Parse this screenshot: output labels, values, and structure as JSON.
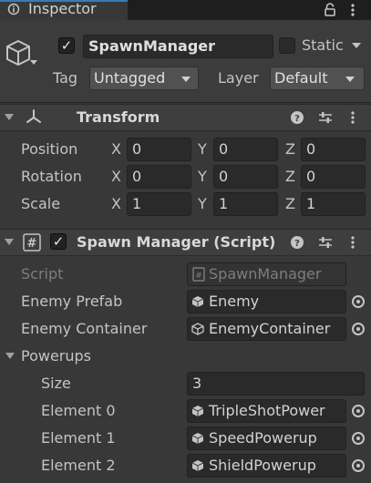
{
  "window": {
    "tab_title": "Inspector"
  },
  "header": {
    "object_name": "SpawnManager",
    "static_label": "Static",
    "tag_label": "Tag",
    "tag_value": "Untagged",
    "layer_label": "Layer",
    "layer_value": "Default"
  },
  "transform": {
    "title": "Transform",
    "rows": [
      {
        "label": "Position",
        "x": "0",
        "y": "0",
        "z": "0"
      },
      {
        "label": "Rotation",
        "x": "0",
        "y": "0",
        "z": "0"
      },
      {
        "label": "Scale",
        "x": "1",
        "y": "1",
        "z": "1"
      }
    ],
    "axis_x": "X",
    "axis_y": "Y",
    "axis_z": "Z"
  },
  "script_component": {
    "title": "Spawn Manager (Script)",
    "script_label": "Script",
    "script_value": "SpawnManager",
    "enemy_prefab_label": "Enemy Prefab",
    "enemy_prefab_value": "Enemy",
    "enemy_container_label": "Enemy Container",
    "enemy_container_value": "EnemyContainer",
    "powerups_label": "Powerups",
    "size_label": "Size",
    "size_value": "3",
    "elements": [
      {
        "label": "Element 0",
        "value": "TripleShotPower"
      },
      {
        "label": "Element 1",
        "value": "SpeedPowerup"
      },
      {
        "label": "Element 2",
        "value": "ShieldPowerup"
      }
    ]
  },
  "icons": {
    "tab": "inspector-icon",
    "lock": "lock-icon",
    "menu": "kebab-menu-icon",
    "gameobject": "cube-icon",
    "transform": "transform-axes-icon",
    "script": "script-hash-icon",
    "help": "help-icon",
    "presets": "presets-sliders-icon",
    "prefab": "prefab-cube-icon",
    "object_picker": "object-picker-icon"
  },
  "colors": {
    "background": "#383838",
    "field": "#2a2a2a",
    "accent": "#3a79bb"
  }
}
